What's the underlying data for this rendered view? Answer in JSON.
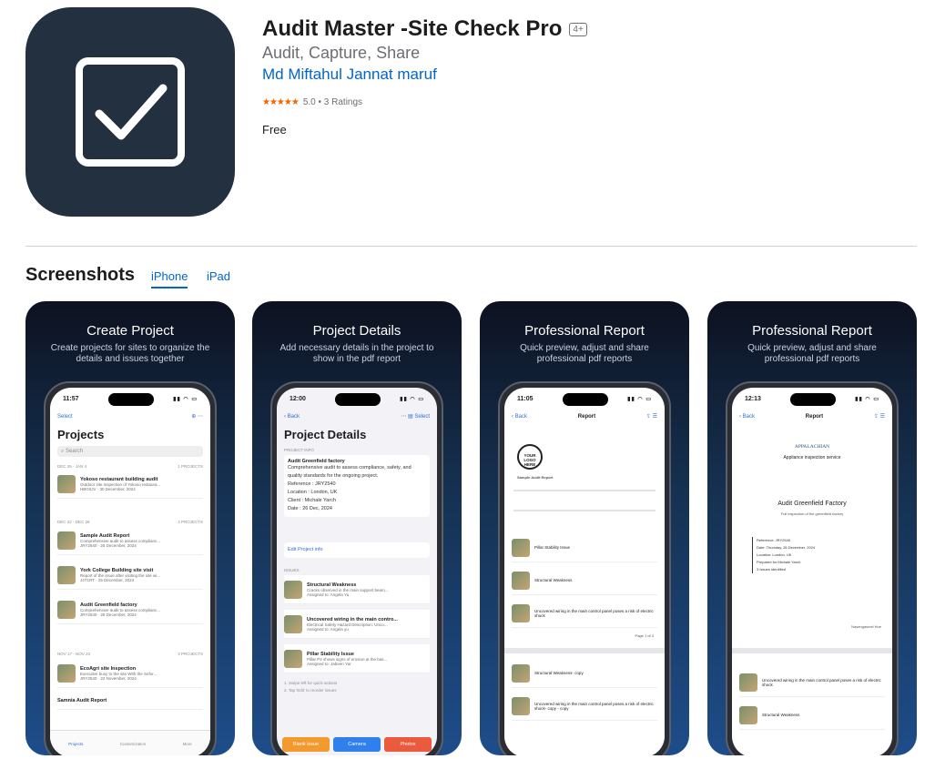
{
  "app": {
    "title": "Audit Master -Site Check Pro",
    "age_rating": "4+",
    "subtitle": "Audit, Capture, Share",
    "developer": "Md Miftahul Jannat maruf",
    "stars": "★★★★★",
    "rating_text": "5.0 • 3 Ratings",
    "rating_value": 5.0,
    "price": "Free",
    "icon": "checkbox-check-icon",
    "icon_bg": "#22303f"
  },
  "screenshots": {
    "heading": "Screenshots",
    "tabs": [
      {
        "label": "iPhone",
        "selected": true
      },
      {
        "label": "iPad",
        "selected": false
      }
    ],
    "items": [
      {
        "title": "Create Project",
        "caption": "Create projects for sites to organize the details and issues together",
        "time": "11:57",
        "nav_left": "Select",
        "screen_title": "Projects",
        "search_placeholder": "Search",
        "groups": [
          {
            "range": "DEC 29 - JAN 4",
            "count": "1 PROJECTS"
          },
          {
            "range": "DEC 22 - DEC 28",
            "count": "3 PROJECTS"
          },
          {
            "range": "NOV 17 - NOV 23",
            "count": "3 PROJECTS"
          }
        ],
        "rows": [
          {
            "title": "Yokoso restaurant building audit",
            "sub": "Outdoor site inspection of Yokoso restaura...",
            "meta": "HBG0JV · 30 December, 2024"
          },
          {
            "title": "Sample Audit Report",
            "sub": "Comprehensive audit to assess complianc...",
            "meta": "JRY2540 · 26 December, 2024"
          },
          {
            "title": "York College Building site visit",
            "sub": "Report of the issue after visiting the site wi...",
            "meta": "J4T1RT · 25 December, 2024"
          },
          {
            "title": "Audit Greenfield factory",
            "sub": "Comprehensive audit to assess complianc...",
            "meta": "JRY2540 · 26 December, 2024"
          },
          {
            "title": "EcoAgri site Inspection",
            "sub": "Executive busy to the site With the Sefor...",
            "meta": "JRY2540 · 22 November, 2024"
          },
          {
            "title": "Samnia Audit Report",
            "sub": "",
            "meta": ""
          }
        ],
        "tabbar": [
          "Projects",
          "Customization",
          "More"
        ]
      },
      {
        "title": "Project Details",
        "caption": "Add necessary details in the project to show in the pdf report",
        "time": "12:00",
        "nav_left": "Back",
        "nav_right": "Select",
        "screen_title": "Project Details",
        "section_info": "PROJECT INFO",
        "project_name": "Audit Greenfield factory",
        "project_desc": "Comprehensive audit to assess compliance, safety, and quality standards for the ongoing project.",
        "fields": [
          {
            "label": "Reference",
            "value": "JRY2540"
          },
          {
            "label": "Location",
            "value": "London, UK"
          },
          {
            "label": "Client",
            "value": "Michale Yarch"
          },
          {
            "label": "Date",
            "value": "26 Dec, 2024"
          }
        ],
        "edit_link": "Edit Project info",
        "section_issues": "ISSUES",
        "issues": [
          {
            "title": "Structural Weakness",
            "sub": "Cracks observed in the main support beam...",
            "meta": "Assigned to: Angela Yu"
          },
          {
            "title": "Uncovered wiring in the main contro...",
            "sub": "Electrical Safety Hazard Description: Unco...",
            "meta": "Assigned to: Angela yu"
          },
          {
            "title": "Pillar Stability Issue",
            "sub": "Pillar P4 shows signs of erosion at the bas...",
            "meta": "Assigned to: Jabeen Yar"
          }
        ],
        "tips": [
          "1. Swipe left for quick actions",
          "2. Tap 'Edit' to reorder issues"
        ],
        "buttons": [
          {
            "label": "Blank issue",
            "color": "#f29a2e"
          },
          {
            "label": "Camera",
            "color": "#2f80ed"
          },
          {
            "label": "Photos",
            "color": "#eb5a3c"
          }
        ]
      },
      {
        "title": "Professional Report",
        "caption": "Quick preview, adjust and share professional pdf reports",
        "time": "11:05",
        "nav_left": "Back",
        "screen_title": "Report",
        "logo_text": "YOUR LOGO HERE",
        "doc_title": "Sample Audit Report",
        "issues": [
          "Pillar Stability Issue",
          "Structural Weakness",
          "Uncovered wiring in the main control panel poses a risk of electric shock",
          "Structural Weakness- copy",
          "Uncovered wiring in the main control panel poses a risk of electric shock- copy - copy"
        ],
        "page": "Page 1 of 3"
      },
      {
        "title": "Professional Report",
        "caption": "Quick preview, adjust and share professional pdf reports",
        "time": "12:13",
        "nav_left": "Back",
        "screen_title": "Report",
        "company": "APPALACHIAN",
        "company_sub": "Appliance inspection service",
        "doc_title": "Audit Greenfield Factory",
        "doc_subtitle": "Full inspection of the greenfield factory",
        "lines": [
          "Reference: JRY2540",
          "Date: Thursday, 26 December, 2024",
          "Location: London, UK",
          "Prepared for Michale Yarch",
          "3 Issues identified"
        ],
        "signer": "Nayengasmel Hue",
        "issues": [
          "Uncovered wiring in the main control panel poses a risk of electric shock",
          "Structural Weakness"
        ]
      }
    ]
  }
}
